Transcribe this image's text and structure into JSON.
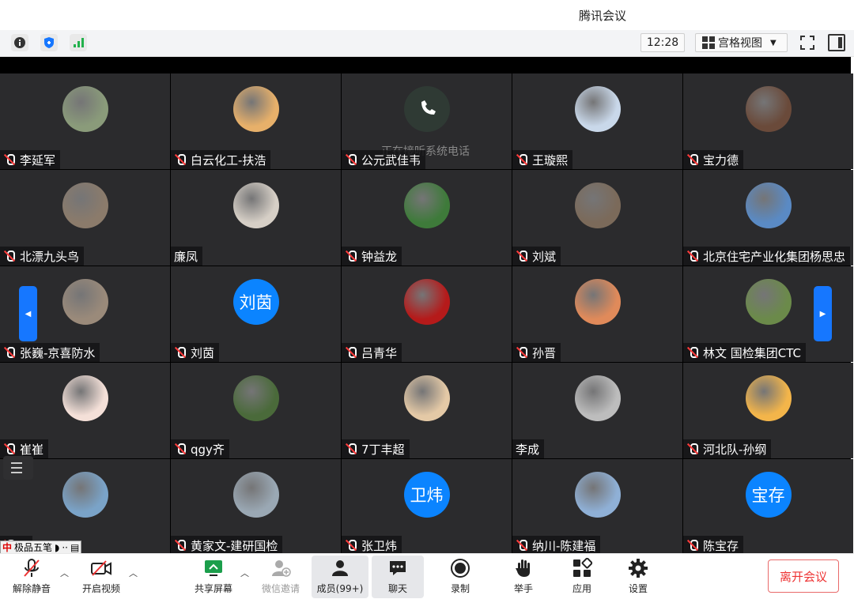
{
  "window": {
    "title": "腾讯会议"
  },
  "toolbar": {
    "time": "12:28",
    "view_mode": "宫格视图"
  },
  "tiles": [
    {
      "name": "李延军",
      "muted": true,
      "avatar": "photo",
      "avatar_color": "#8a9b7a"
    },
    {
      "name": "白云化工-扶浩",
      "muted": true,
      "avatar": "photo",
      "avatar_color": "#e7b06a"
    },
    {
      "name": "公元武佳韦",
      "muted": true,
      "avatar": "phone",
      "avatar_color": "#2f3a34",
      "note": "正在接听系统电话"
    },
    {
      "name": "王璇熙",
      "muted": true,
      "avatar": "photo",
      "avatar_color": "#c9d8ea"
    },
    {
      "name": "宝力德",
      "muted": true,
      "avatar": "photo",
      "avatar_color": "#6a4a3a"
    },
    {
      "name": "北漂九头鸟",
      "muted": true,
      "avatar": "photo",
      "avatar_color": "#8b7b6b"
    },
    {
      "name": "廉凤",
      "muted": false,
      "avatar": "photo",
      "avatar_color": "#d6cfc6"
    },
    {
      "name": "钟益龙",
      "muted": true,
      "avatar": "photo",
      "avatar_color": "#3e7a3a"
    },
    {
      "name": "刘斌",
      "muted": true,
      "avatar": "photo",
      "avatar_color": "#7b6a5a"
    },
    {
      "name": "北京住宅产业化集团杨思忠",
      "muted": true,
      "avatar": "photo",
      "avatar_color": "#5a8ac4"
    },
    {
      "name": "张巍-京喜防水",
      "muted": true,
      "avatar": "photo",
      "avatar_color": "#9a8a7a"
    },
    {
      "name": "刘茵",
      "muted": true,
      "avatar": "letter",
      "avatar_color": "#0b84ff",
      "letter": "刘茵"
    },
    {
      "name": "吕青华",
      "muted": true,
      "avatar": "photo",
      "avatar_color": "#b51a1a"
    },
    {
      "name": "孙晋",
      "muted": true,
      "avatar": "photo",
      "avatar_color": "#e08a5a"
    },
    {
      "name": "林文 国检集团CTC",
      "muted": true,
      "avatar": "photo",
      "avatar_color": "#6b8a4a"
    },
    {
      "name": "崔崔",
      "muted": true,
      "avatar": "photo",
      "avatar_color": "#f4e0d8"
    },
    {
      "name": "qgy齐",
      "muted": true,
      "avatar": "photo",
      "avatar_color": "#4a6a3a"
    },
    {
      "name": "7丁丰超",
      "muted": true,
      "avatar": "photo",
      "avatar_color": "#e4c9a6"
    },
    {
      "name": "李成",
      "muted": false,
      "avatar": "photo",
      "avatar_color": "#bdbdbd"
    },
    {
      "name": "河北队-孙纲",
      "muted": true,
      "avatar": "photo",
      "avatar_color": "#f3b54a"
    },
    {
      "name": "C",
      "muted": true,
      "avatar": "photo",
      "avatar_color": "#7aa3c8"
    },
    {
      "name": "黄家文-建研国检",
      "muted": true,
      "avatar": "photo",
      "avatar_color": "#9aa8b4"
    },
    {
      "name": "张卫炜",
      "muted": true,
      "avatar": "letter",
      "avatar_color": "#0b84ff",
      "letter": "卫炜"
    },
    {
      "name": "纳川-陈建福",
      "muted": true,
      "avatar": "photo",
      "avatar_color": "#8fb0d6"
    },
    {
      "name": "陈宝存",
      "muted": true,
      "avatar": "letter",
      "avatar_color": "#0b84ff",
      "letter": "宝存"
    }
  ],
  "ime": {
    "label": "极品五笔"
  },
  "bottom": {
    "unmute": "解除静音",
    "start_video": "开启视频",
    "share_screen": "共享屏幕",
    "wechat_invite": "微信邀请",
    "members": "成员(99+)",
    "chat": "聊天",
    "record": "录制",
    "raise_hand": "举手",
    "apps": "应用",
    "settings": "设置",
    "leave": "离开会议"
  },
  "colors": {
    "accent": "#0b84ff",
    "leave": "#e33333",
    "tile_bg": "#2b2b2d"
  }
}
